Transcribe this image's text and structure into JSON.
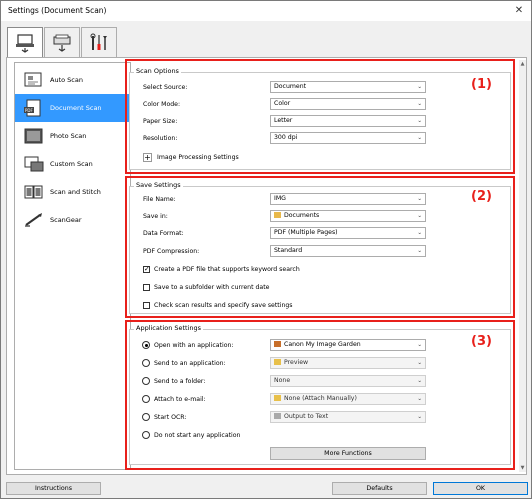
{
  "window": {
    "title": "Settings (Document Scan)"
  },
  "tabs": [
    {
      "name": "scan-from-computer-icon"
    },
    {
      "name": "scan-from-operation-panel-icon"
    },
    {
      "name": "general-settings-icon"
    }
  ],
  "sidebar": {
    "items": [
      {
        "label": "Auto Scan",
        "icon": "auto-scan-icon"
      },
      {
        "label": "Document Scan",
        "icon": "document-scan-icon"
      },
      {
        "label": "Photo Scan",
        "icon": "photo-scan-icon"
      },
      {
        "label": "Custom Scan",
        "icon": "custom-scan-icon"
      },
      {
        "label": "Scan and Stitch",
        "icon": "scan-and-stitch-icon"
      },
      {
        "label": "ScanGear",
        "icon": "scangear-icon"
      }
    ]
  },
  "annotations": {
    "one": "(1)",
    "two": "(2)",
    "three": "(3)"
  },
  "scan_options": {
    "title": "Scan Options",
    "select_source": {
      "label": "Select Source:",
      "value": "Document"
    },
    "color_mode": {
      "label": "Color Mode:",
      "value": "Color"
    },
    "paper_size": {
      "label": "Paper Size:",
      "value": "Letter"
    },
    "resolution": {
      "label": "Resolution:",
      "value": "300 dpi"
    },
    "expand": "+",
    "image_processing": "Image Processing Settings"
  },
  "save_settings": {
    "title": "Save Settings",
    "file_name": {
      "label": "File Name:",
      "value": "IMG"
    },
    "save_in": {
      "label": "Save in:",
      "value": "Documents"
    },
    "data_format": {
      "label": "Data Format:",
      "value": "PDF (Multiple Pages)"
    },
    "pdf_compression": {
      "label": "PDF Compression:",
      "value": "Standard"
    },
    "keyword_search": {
      "label": "Create a PDF file that supports keyword search",
      "checked": true
    },
    "subfolder": {
      "label": "Save to a subfolder with current date",
      "checked": false
    },
    "check_results": {
      "label": "Check scan results and specify save settings",
      "checked": false
    }
  },
  "app_settings": {
    "title": "Application Settings",
    "open_app": {
      "label": "Open with an application:",
      "value": "Canon My Image Garden",
      "selected": true
    },
    "send_app": {
      "label": "Send to an application:",
      "value": "Preview"
    },
    "send_folder": {
      "label": "Send to a folder:",
      "value": "None"
    },
    "attach_email": {
      "label": "Attach to e-mail:",
      "value": "None (Attach Manually)"
    },
    "start_ocr": {
      "label": "Start OCR:",
      "value": "Output to Text"
    },
    "no_app": {
      "label": "Do not start any application"
    },
    "more_functions": "More Functions"
  },
  "footer": {
    "instructions": "Instructions",
    "defaults": "Defaults",
    "ok": "OK"
  },
  "colors": {
    "accent_red": "#e8201b",
    "selection_blue": "#3399ff"
  }
}
